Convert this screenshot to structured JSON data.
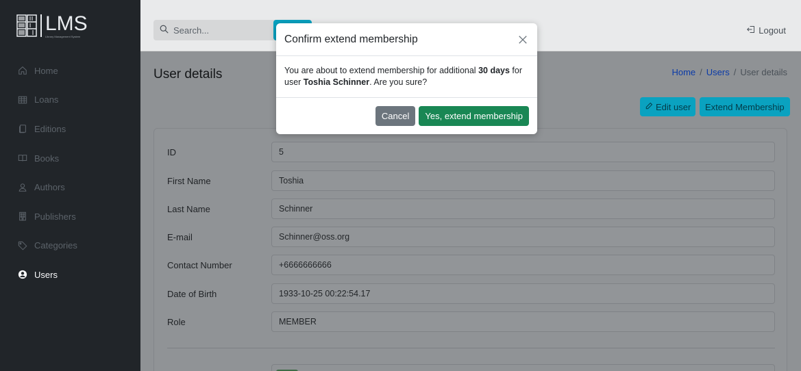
{
  "app": {
    "logo_text": "LMS",
    "logo_subtitle": "Library Management System"
  },
  "sidebar": {
    "items": [
      {
        "label": "Home",
        "icon": "home-icon"
      },
      {
        "label": "Loans",
        "icon": "table-icon"
      },
      {
        "label": "Editions",
        "icon": "copy-icon"
      },
      {
        "label": "Books",
        "icon": "book-icon"
      },
      {
        "label": "Authors",
        "icon": "person-icon"
      },
      {
        "label": "Publishers",
        "icon": "building-icon"
      },
      {
        "label": "Categories",
        "icon": "tag-icon"
      },
      {
        "label": "Users",
        "icon": "user-circle-icon",
        "active": true
      }
    ]
  },
  "header": {
    "search_placeholder": "Search...",
    "logout_label": "Logout"
  },
  "page": {
    "title": "User details",
    "breadcrumb": [
      "Home",
      "Users",
      "User details"
    ],
    "breadcrumb_sep": "/",
    "edit_button": "Edit user",
    "extend_button": "Extend Membership"
  },
  "details": [
    {
      "label": "ID",
      "value": "5"
    },
    {
      "label": "First Name",
      "value": "Toshia"
    },
    {
      "label": "Last Name",
      "value": "Schinner"
    },
    {
      "label": "E-mail",
      "value": "Schinner@oss.org"
    },
    {
      "label": "Contact Number",
      "value": "+6666666666"
    },
    {
      "label": "Date of Birth",
      "value": "1933-10-25 00:22:54.17"
    },
    {
      "label": "Role",
      "value": "MEMBER"
    }
  ],
  "modal": {
    "title": "Confirm extend membership",
    "body_prefix": "You are about to extend membership for additional ",
    "body_days": "30 days",
    "body_mid": " for user ",
    "body_user": "Toshia Schinner",
    "body_suffix": ". Are you sure?",
    "cancel_label": "Cancel",
    "confirm_label": "Yes, extend membership"
  },
  "colors": {
    "sidebar_bg": "#212529",
    "accent_info": "#0aa2c0",
    "success": "#198754",
    "secondary": "#6c757d"
  }
}
